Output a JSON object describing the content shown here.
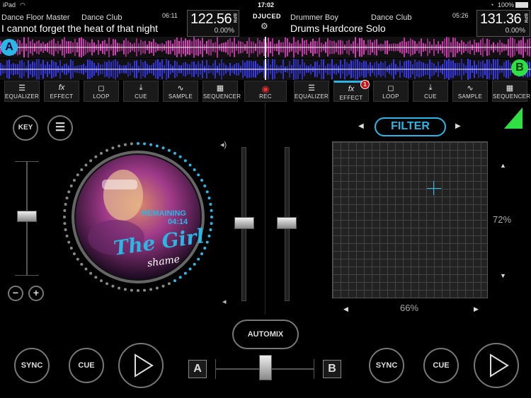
{
  "status": {
    "device": "iPad",
    "clock": "17:02",
    "battery": "100%"
  },
  "brand": "DJUCED",
  "deck_a": {
    "artist": "Dance Floor Master",
    "album": "Dance Club",
    "time": "06:11",
    "title": "I cannot forget the heat of that night",
    "bpm": "122.56",
    "bpm_unit": "BPM",
    "pitch": "0.00%",
    "deck_letter": "A",
    "remaining_label": "REMAINING",
    "remaining_time": "04:14",
    "key_label": "KEY",
    "sync_label": "SYNC",
    "cue_label": "CUE",
    "minus": "−",
    "plus": "+"
  },
  "deck_b": {
    "artist": "Drummer Boy",
    "album": "Dance Club",
    "time": "05:26",
    "title": "Drums Hardcore Solo",
    "bpm": "131.36",
    "bpm_unit": "BPM",
    "pitch": "0.00%",
    "deck_letter": "B",
    "sync_label": "SYNC",
    "cue_label": "CUE",
    "fx_badge": "1",
    "filter_label": "FILTER",
    "x_value": "66%",
    "y_value": "72%"
  },
  "toolbar_a": [
    "EQUALIZER",
    "EFFECT",
    "LOOP",
    "CUE",
    "SAMPLE",
    "SEQUENCER"
  ],
  "rec_label": "REC",
  "toolbar_b": [
    "EQUALIZER",
    "EFFECT",
    "LOOP",
    "CUE",
    "SAMPLE",
    "SEQUENCER"
  ],
  "mixer": {
    "automix_label": "AUTOMIX",
    "xfade_a": "A",
    "xfade_b": "B"
  },
  "artwork": {
    "line1": "The Girl",
    "line2": "shame"
  },
  "colors": {
    "accent": "#2ab7e6",
    "deck_a_wave": "#e83cc8",
    "deck_b_wave": "#3a3cff",
    "green": "#2ee044",
    "rec": "#e23030"
  }
}
